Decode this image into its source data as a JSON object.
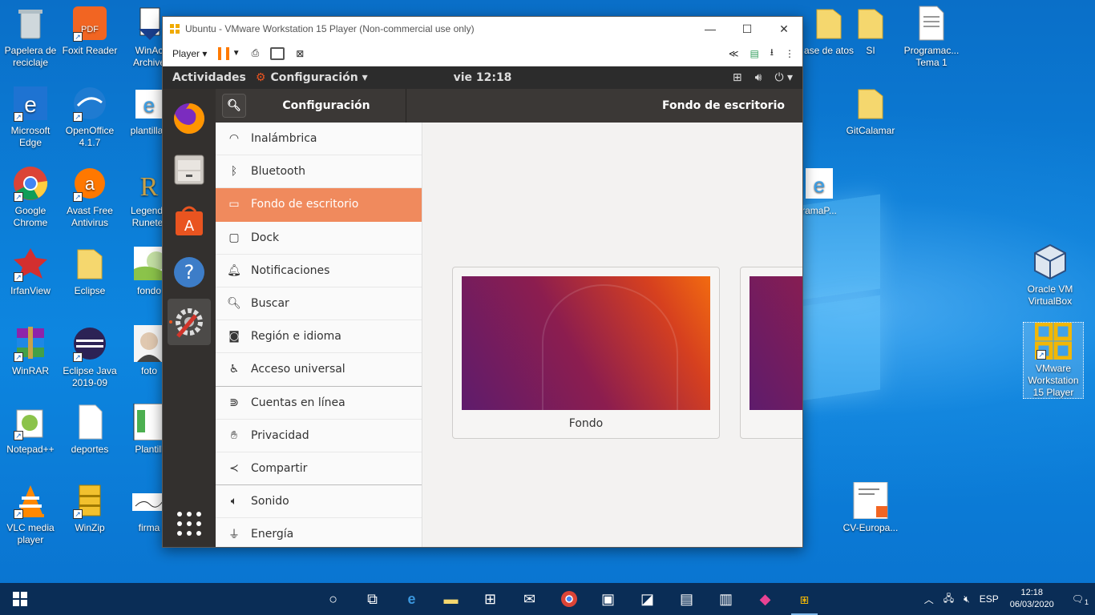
{
  "desktop": {
    "icons": [
      {
        "label": "Papelera de reciclaje",
        "icon": "recycle-bin-icon",
        "color": "#cfd8dc"
      },
      {
        "label": "Foxit Reader",
        "icon": "foxit-pdf-icon",
        "color": "#f26522"
      },
      {
        "label": "WinAc Archive",
        "icon": "winace-icon",
        "color": "#1a3e8c"
      },
      {
        "label": "Microsoft Edge",
        "icon": "edge-icon",
        "color": "#1e73d2"
      },
      {
        "label": "OpenOffice 4.1.7",
        "icon": "openoffice-icon",
        "color": "#1f7bd1"
      },
      {
        "label": "plantillax",
        "icon": "ie-icon",
        "color": "#3aa0e8"
      },
      {
        "label": "Google Chrome",
        "icon": "chrome-icon",
        "color": "#db4437"
      },
      {
        "label": "Avast Free Antivirus",
        "icon": "avast-icon",
        "color": "#ff7800"
      },
      {
        "label": "Legends Runeter",
        "icon": "legends-icon",
        "color": "#c8a24a"
      },
      {
        "label": "IrfanView",
        "icon": "irfanview-icon",
        "color": "#d32f2f"
      },
      {
        "label": "Eclipse",
        "icon": "folder-icon",
        "color": "#f5d76e"
      },
      {
        "label": "fondo",
        "icon": "image-file-icon",
        "color": "#8bc34a"
      },
      {
        "label": "WinRAR",
        "icon": "winrar-icon",
        "color": "#8e24aa"
      },
      {
        "label": "Eclipse Java 2019-09",
        "icon": "eclipse-icon",
        "color": "#2c2255"
      },
      {
        "label": "foto",
        "icon": "photo-icon",
        "color": "#e0c8b0"
      },
      {
        "label": "Notepad++",
        "icon": "notepadpp-icon",
        "color": "#8bc34a"
      },
      {
        "label": "deportes",
        "icon": "blank-file-icon",
        "color": "#ffffff"
      },
      {
        "label": "Plantill",
        "icon": "document-icon",
        "color": "#4caf50"
      },
      {
        "label": "VLC media player",
        "icon": "vlc-icon",
        "color": "#ff8800"
      },
      {
        "label": "WinZip",
        "icon": "winzip-icon",
        "color": "#f2c12e"
      },
      {
        "label": "firma",
        "icon": "signature-icon",
        "color": "#ffffff"
      }
    ],
    "right_icons": [
      {
        "label": "ase de atos",
        "icon": "folder-icon"
      },
      {
        "label": "SI",
        "icon": "folder-icon"
      },
      {
        "label": "Programac... Tema 1",
        "icon": "text-file-icon"
      },
      {
        "label": "GitCalamar",
        "icon": "folder-icon"
      },
      {
        "label": "ramaP...",
        "icon": "ie-icon"
      },
      {
        "label": "Oracle VM VirtualBox",
        "icon": "virtualbox-icon"
      },
      {
        "label": "VMware Workstation 15 Player",
        "icon": "vmware-icon"
      },
      {
        "label": "CV-Europa...",
        "icon": "pdf-doc-icon"
      }
    ]
  },
  "vm_window": {
    "title": "Ubuntu - VMware Workstation 15 Player (Non-commercial use only)",
    "player_menu": "Player"
  },
  "ubuntu": {
    "activities": "Actividades",
    "app_menu": "Configuración",
    "clock": "vie 12:18",
    "settings_title": "Configuración",
    "panel_title": "Fondo de escritorio",
    "sidebar": [
      {
        "label": "Inalámbrica",
        "icon": "wifi-icon"
      },
      {
        "label": "Bluetooth",
        "icon": "bluetooth-icon"
      },
      {
        "label": "Fondo de escritorio",
        "icon": "background-icon",
        "active": true
      },
      {
        "label": "Dock",
        "icon": "dock-icon"
      },
      {
        "label": "Notificaciones",
        "icon": "bell-icon"
      },
      {
        "label": "Buscar",
        "icon": "search-icon"
      },
      {
        "label": "Región e idioma",
        "icon": "camera-icon"
      },
      {
        "label": "Acceso universal",
        "icon": "accessibility-icon"
      },
      {
        "label": "Cuentas en línea",
        "icon": "online-accounts-icon"
      },
      {
        "label": "Privacidad",
        "icon": "hand-icon"
      },
      {
        "label": "Compartir",
        "icon": "share-icon"
      },
      {
        "label": "Sonido",
        "icon": "speaker-icon"
      },
      {
        "label": "Energía",
        "icon": "power-plug-icon"
      }
    ],
    "wallpaper_cards": [
      {
        "label": "Fondo"
      },
      {
        "label": ""
      }
    ]
  },
  "taskbar": {
    "language": "ESP",
    "time": "12:18",
    "date": "06/03/2020",
    "notification_count": "1"
  }
}
